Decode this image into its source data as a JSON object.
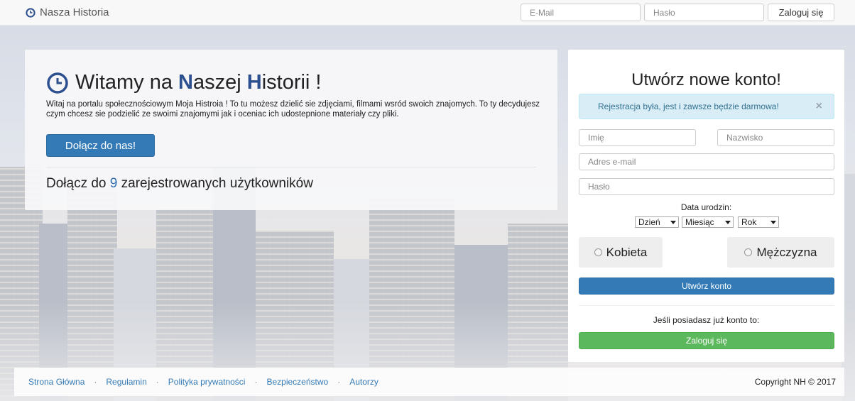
{
  "navbar": {
    "brand": "Nasza Historia",
    "email_placeholder": "E-Mail",
    "password_placeholder": "Hasło",
    "login_label": "Zaloguj się"
  },
  "welcome": {
    "title_prefix": "Witamy na ",
    "title_n": "N",
    "title_aszej": "aszej ",
    "title_h": "H",
    "title_istorii": "istorii",
    "title_suffix": " !",
    "description": "Witaj na portalu społecznościowym Moja Histroia ! To tu możesz dzielić sie zdjęciami, filmami wsród swoich znajomych. To ty decydujesz czym chcesz sie podzielić ze swoimi znajomymi jak i oceniac ich udostepnione materiały czy pliki.",
    "join_label": "Dołącz do nas!",
    "count_prefix": "Dołącz do ",
    "count_value": "9",
    "count_suffix": " zarejestrowanych użytkowników"
  },
  "register": {
    "title": "Utwórz nowe konto!",
    "alert": "Rejestracja była, jest i zawsze będzie darmowa!",
    "alert_close": "×",
    "first_name_placeholder": "Imię",
    "last_name_placeholder": "Nazwisko",
    "email_placeholder": "Adres e-mail",
    "password_placeholder": "Hasło",
    "dob_label": "Data urodzin:",
    "day": "Dzień",
    "month": "Miesiąc",
    "year": "Rok",
    "female": "Kobieta",
    "male": "Mężczyzna",
    "create_label": "Utwórz konto",
    "have_account": "Jeśli posiadasz już konto to:",
    "login_label": "Zaloguj się"
  },
  "footer": {
    "links": [
      "Strona Główna",
      "Regulamin",
      "Polityka prywatności",
      "Bezpieczeństwo",
      "Autorzy"
    ],
    "copyright": "Copyright NH © 2017"
  },
  "colors": {
    "primary": "#337ab7",
    "success": "#5cb85c",
    "alert_bg": "#d9edf7",
    "title_accent": "#2b4f8f"
  }
}
